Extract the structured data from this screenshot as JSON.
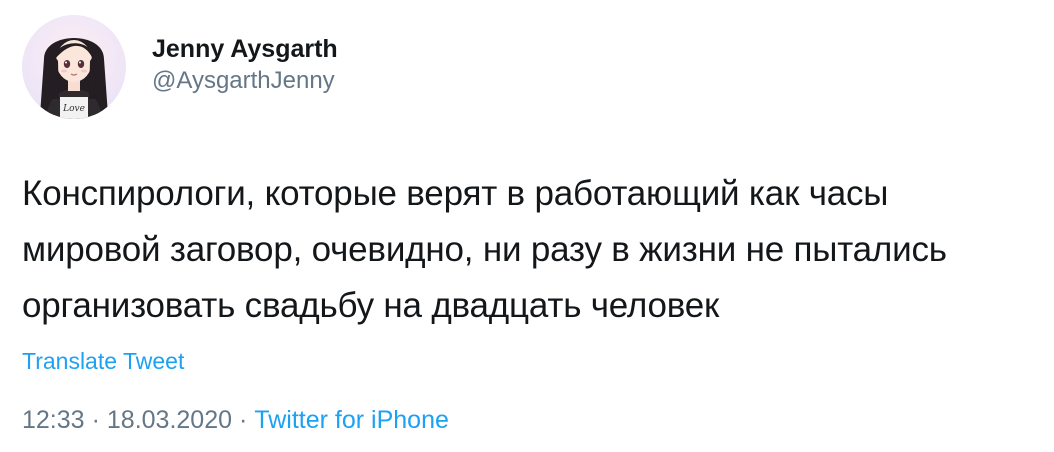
{
  "author": {
    "display_name": "Jenny Aysgarth",
    "handle": "@AysgarthJenny",
    "avatar_shirt_text": "Love"
  },
  "tweet": {
    "text": "Конспирологи, которые верят в работающий как часы\nмировой заговор, очевидно, ни разу в жизни не пытались\nорганизовать свадьбу на двадцать человек",
    "translate_label": "Translate Tweet"
  },
  "meta": {
    "time": "12:33",
    "separator": "·",
    "date": "18.03.2020",
    "source": "Twitter for iPhone"
  },
  "colors": {
    "text": "#14171a",
    "secondary": "#657786",
    "link": "#1da1f2"
  },
  "icons": {
    "avatar": "anime-girl-avatar"
  }
}
